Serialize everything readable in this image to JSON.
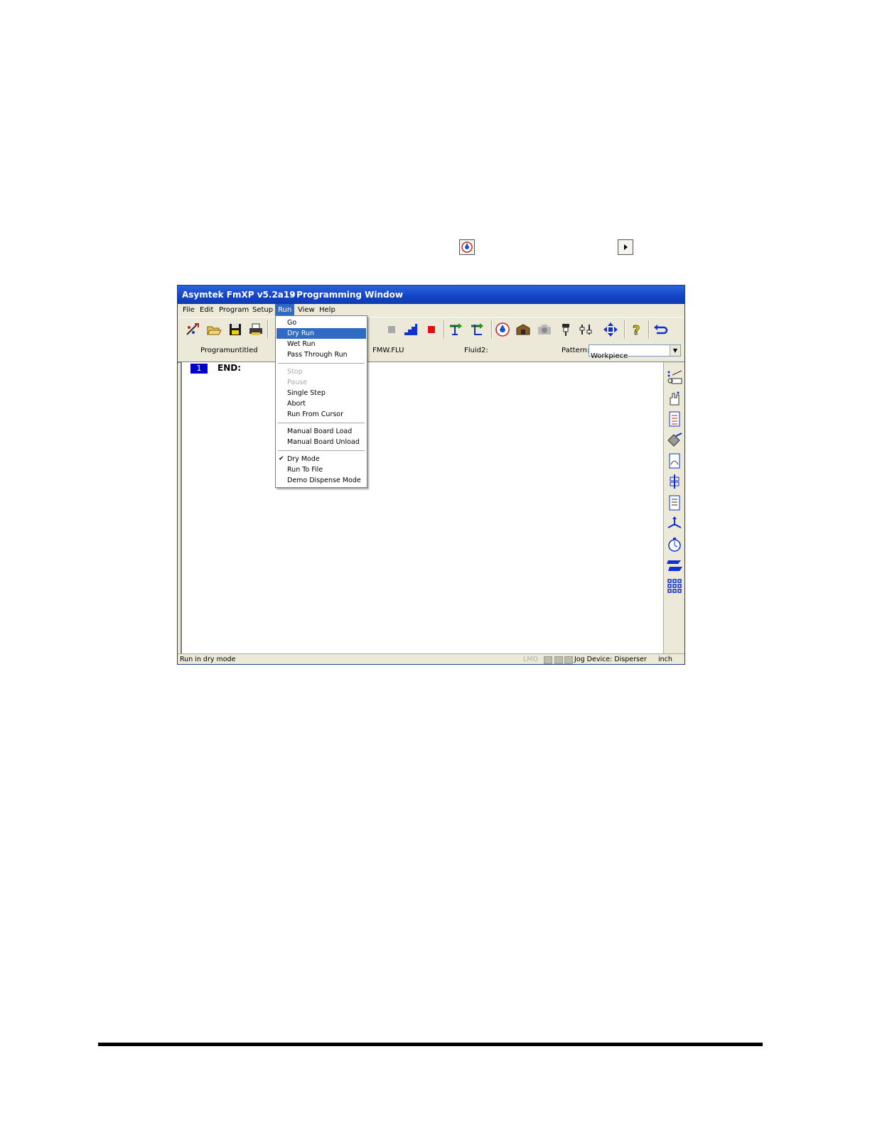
{
  "window": {
    "title_app": "Asymtek FmXP v5.2a19",
    "title_window": "- Programming Window"
  },
  "menubar": {
    "items": [
      "File",
      "Edit",
      "Program",
      "Setup",
      "Run",
      "View",
      "Help"
    ],
    "open_menu": "Run"
  },
  "infobar": {
    "program_label": "Program:",
    "program_value": "untitled",
    "fluid_file": "FMW.FLU",
    "fluid2_label": "Fluid2:",
    "pattern_label": "Pattern:",
    "pattern_value": "Workpiece"
  },
  "editor": {
    "line_number": "1",
    "line_text": "END:"
  },
  "run_menu": {
    "items": [
      {
        "label": "Go",
        "state": "normal"
      },
      {
        "label": "Dry Run",
        "state": "highlighted"
      },
      {
        "label": "Wet Run",
        "state": "normal"
      },
      {
        "label": "Pass Through Run",
        "state": "normal"
      },
      {
        "label": "Stop",
        "state": "disabled"
      },
      {
        "label": "Pause",
        "state": "disabled"
      },
      {
        "label": "Single Step",
        "state": "normal"
      },
      {
        "label": "Abort",
        "state": "normal"
      },
      {
        "label": "Run From Cursor",
        "state": "normal"
      },
      {
        "label": "Manual Board Load",
        "state": "normal"
      },
      {
        "label": "Manual Board Unload",
        "state": "normal"
      },
      {
        "label": "Dry Mode",
        "state": "checked"
      },
      {
        "label": "Run To File",
        "state": "normal"
      },
      {
        "label": "Demo Dispense Mode",
        "state": "normal"
      }
    ]
  },
  "statusbar": {
    "message": "Run in dry mode",
    "lmo": "LMO",
    "jog_device": "Jog Device: Disperser",
    "units": "inch"
  },
  "colors": {
    "titlebar": "#1343c4",
    "menu_highlight": "#316ac5",
    "line_number_bg": "#0000cc"
  }
}
